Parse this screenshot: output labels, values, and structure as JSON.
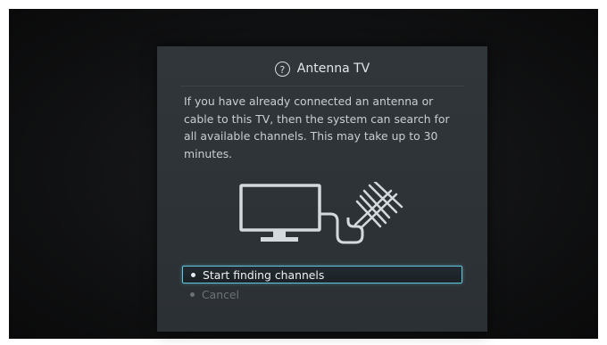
{
  "dialog": {
    "title": "Antenna TV",
    "title_icon": "help-circle-icon",
    "message": "If you have already connected an antenna or cable to this TV, then the system can search for all available channels. This may take up to 30 minutes.",
    "illustration": "tv-antenna-illustration"
  },
  "options": [
    {
      "label": "Start finding channels",
      "selected": true
    },
    {
      "label": "Cancel",
      "selected": false
    }
  ],
  "colors": {
    "dialog_background": "#2e3438",
    "focus_border": "#64c6dc",
    "text": "#c9ced1",
    "dim_text": "#6b7277"
  }
}
